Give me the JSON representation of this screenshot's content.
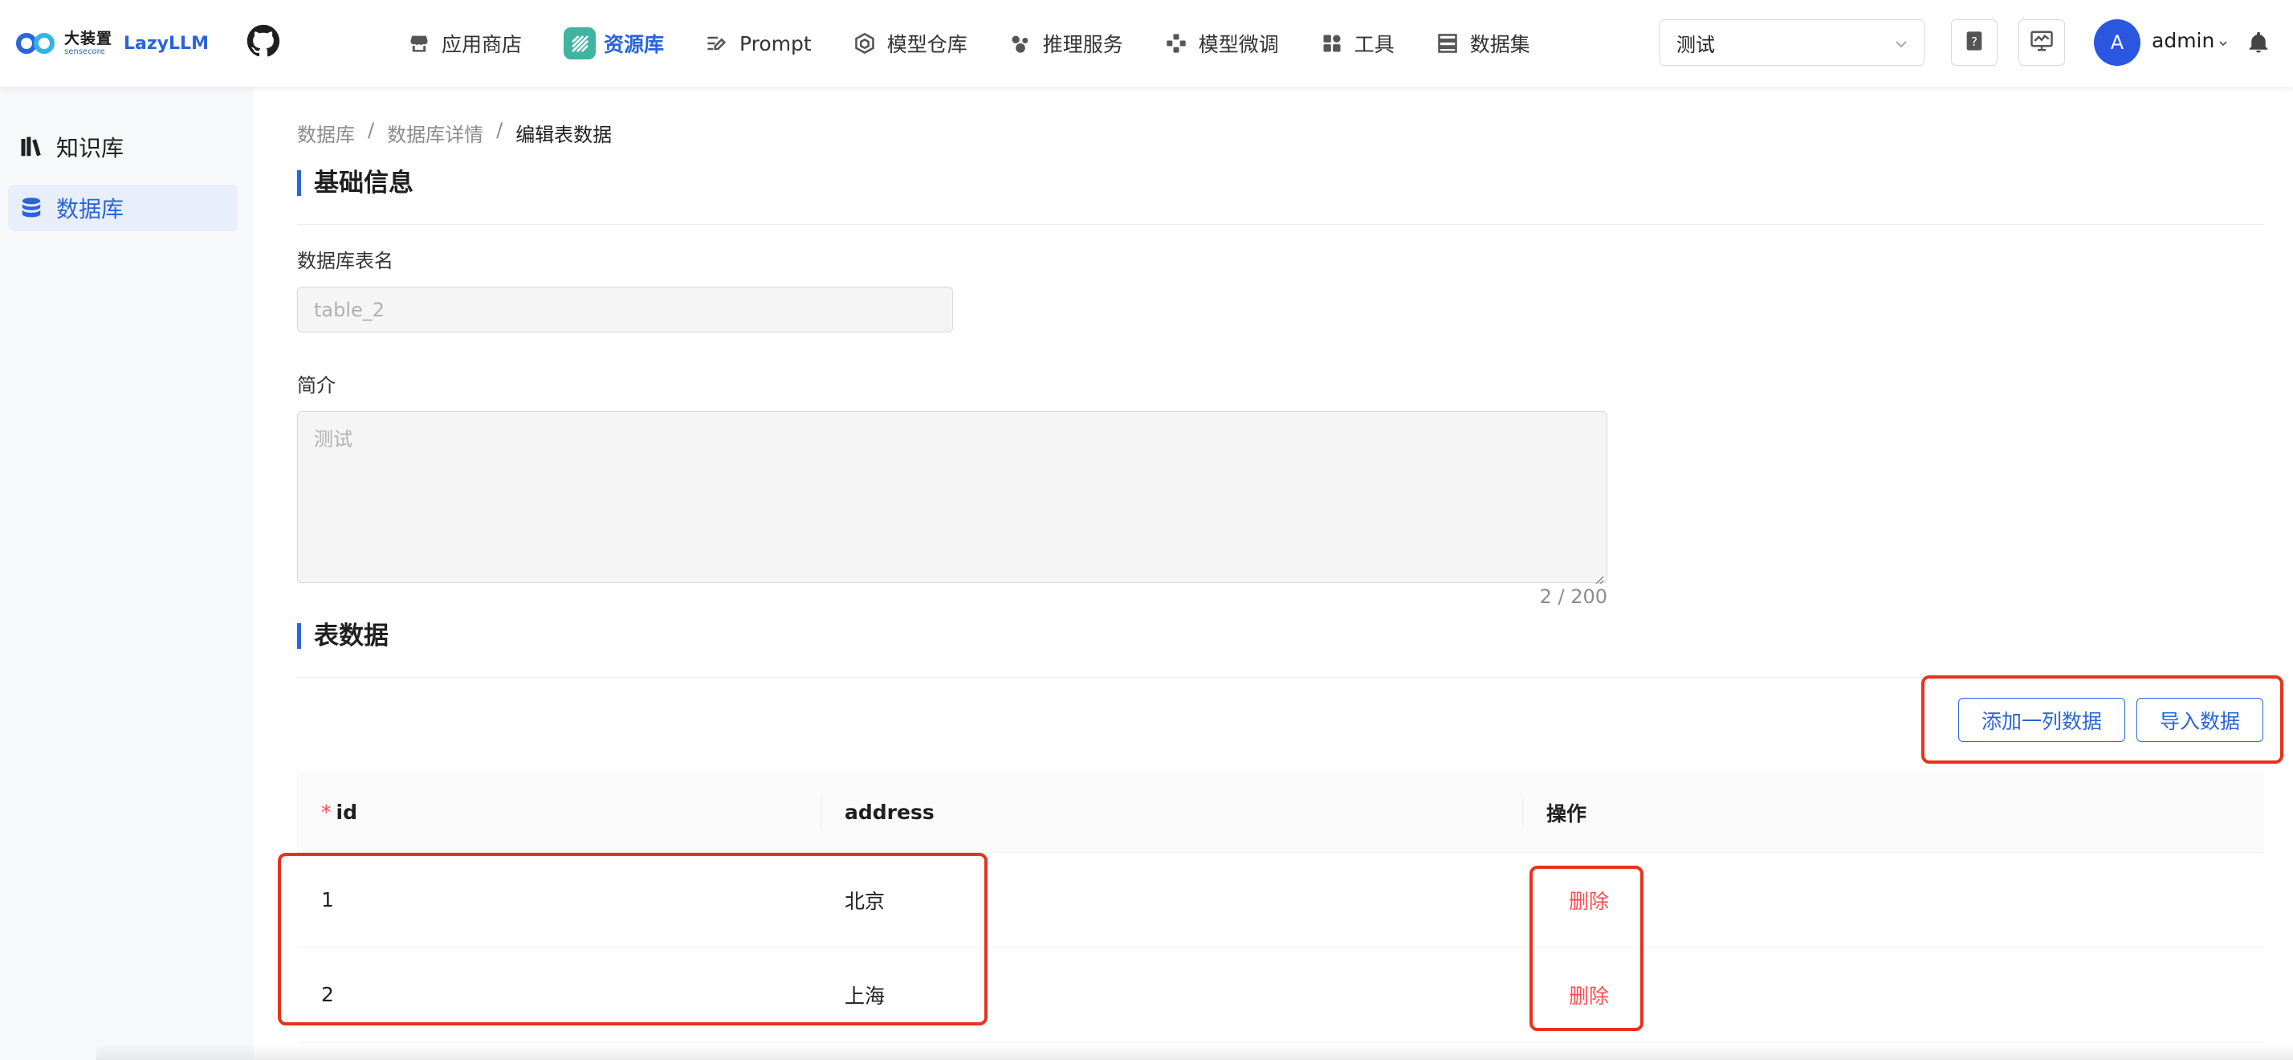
{
  "header": {
    "logo_cn": "大装置",
    "logo_en": "sensecore",
    "app_name": "LazyLLM",
    "nav": [
      {
        "label": "应用商店",
        "icon": "store-icon"
      },
      {
        "label": "资源库",
        "icon": "resource-icon",
        "active": true
      },
      {
        "label": "Prompt",
        "icon": "prompt-icon"
      },
      {
        "label": "模型仓库",
        "icon": "model-hub-icon"
      },
      {
        "label": "推理服务",
        "icon": "inference-icon"
      },
      {
        "label": "模型微调",
        "icon": "finetune-icon"
      },
      {
        "label": "工具",
        "icon": "tools-icon"
      },
      {
        "label": "数据集",
        "icon": "dataset-icon"
      }
    ],
    "project_select_value": "测试",
    "user_initial": "A",
    "user_name": "admin"
  },
  "sidebar": {
    "items": [
      {
        "label": "知识库",
        "icon": "books-icon"
      },
      {
        "label": "数据库",
        "icon": "database-icon",
        "active": true
      }
    ]
  },
  "breadcrumb": [
    "数据库",
    "数据库详情",
    "编辑表数据"
  ],
  "basic_info": {
    "title": "基础信息",
    "table_name_label": "数据库表名",
    "table_name_value": "table_2",
    "desc_label": "简介",
    "desc_value": "测试",
    "desc_counter": "2 / 200"
  },
  "table_data": {
    "title": "表数据",
    "add_column_button": "添加一列数据",
    "import_button": "导入数据",
    "columns": [
      "id",
      "address",
      "操作"
    ],
    "rows": [
      {
        "id": "1",
        "address": "北京",
        "action": "删除"
      },
      {
        "id": "2",
        "address": "上海",
        "action": "删除"
      }
    ]
  },
  "colors": {
    "accent": "#2a64d8",
    "danger": "#ff4d4f",
    "annotation": "#e5341c",
    "active_nav_icon_bg": "#3fb4a0"
  }
}
